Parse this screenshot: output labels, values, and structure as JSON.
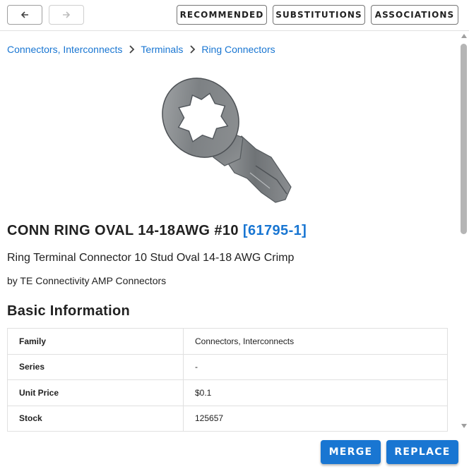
{
  "toolbar": {
    "back_icon": "arrow-left-icon",
    "forward_icon": "arrow-right-icon",
    "tabs": [
      {
        "label": "RECOMMENDED"
      },
      {
        "label": "SUBSTITUTIONS"
      },
      {
        "label": "ASSOCIATIONS"
      }
    ]
  },
  "breadcrumb": {
    "items": [
      {
        "label": "Connectors, Interconnects"
      },
      {
        "label": "Terminals"
      },
      {
        "label": "Ring Connectors"
      }
    ]
  },
  "product": {
    "title": "CONN RING OVAL 14-18AWG #10",
    "part_number": "[61795-1]",
    "description": "Ring Terminal Connector 10 Stud Oval 14-18 AWG Crimp",
    "manufacturer": "by TE Connectivity AMP Connectors"
  },
  "basic_info": {
    "heading": "Basic Information",
    "rows": [
      {
        "label": "Family",
        "value": "Connectors, Interconnects"
      },
      {
        "label": "Series",
        "value": "-"
      },
      {
        "label": "Unit Price",
        "value": "$0.1"
      },
      {
        "label": "Stock",
        "value": "125657"
      }
    ]
  },
  "actions": {
    "merge_label": "MERGE",
    "replace_label": "REPLACE"
  },
  "colors": {
    "accent": "#1976d2",
    "text": "#212121",
    "border": "#e0e0e0"
  }
}
